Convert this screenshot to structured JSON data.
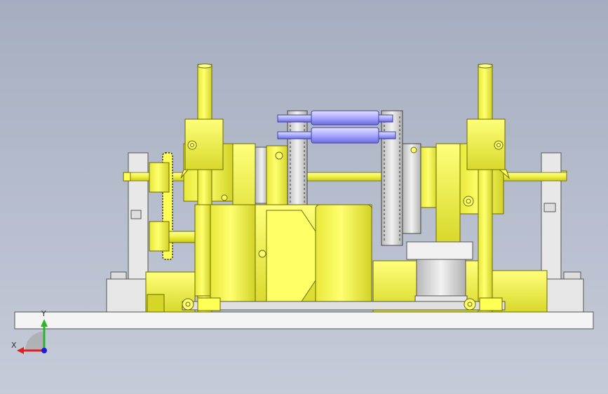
{
  "viewport": {
    "background_top": "#a5aec0",
    "background_bottom": "#c6cbd8"
  },
  "model": {
    "yellow": "#ffff55",
    "yellow_shade": "#d6d62a",
    "yellow_edge": "#6b6b00",
    "gray": "#d4d4d4",
    "gray_edge": "#555555",
    "blue": "#a9a9ff",
    "blue_dark": "#5a5ad0",
    "base_plate": "#f4f4f4"
  },
  "triad": {
    "x_label": "X",
    "y_label": "Y",
    "x_color": "#e0201e",
    "y_color": "#2bb52b",
    "z_color": "#1c1ce0"
  }
}
